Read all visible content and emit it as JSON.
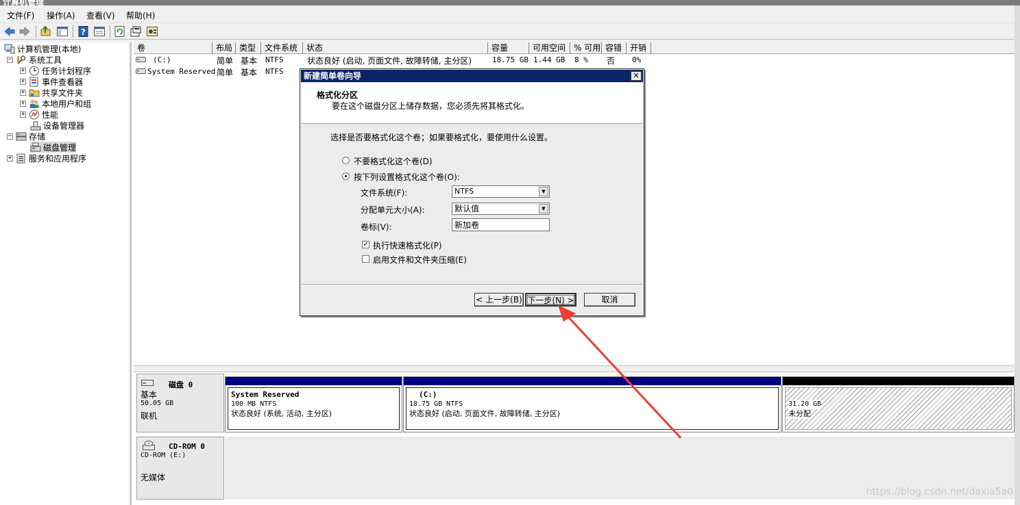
{
  "window": {
    "title": "计算机管理"
  },
  "menu": [
    "文件(F)",
    "操作(A)",
    "查看(V)",
    "帮助(H)"
  ],
  "toolbar": [
    "back-icon",
    "forward-icon",
    "up-icon",
    "show-tree-icon",
    "help-icon",
    "properties-icon",
    "refresh-icon",
    "export-icon",
    "settings-icon"
  ],
  "tree": {
    "root": "计算机管理(本地)",
    "system_tools": "系统工具",
    "task_scheduler": "任务计划程序",
    "event_viewer": "事件查看器",
    "shared_folders": "共享文件夹",
    "local_users": "本地用户和组",
    "performance": "性能",
    "device_manager": "设备管理器",
    "storage": "存储",
    "disk_management": "磁盘管理",
    "services": "服务和应用程序"
  },
  "volumes": {
    "columns": [
      "卷",
      "布局",
      "类型",
      "文件系统",
      "状态",
      "容量",
      "可用空间",
      "% 可用",
      "容错",
      "开销"
    ],
    "rows": [
      {
        "name": "(C:)",
        "layout": "简单",
        "type": "基本",
        "fs": "NTFS",
        "status": "状态良好 (启动, 页面文件, 故障转储, 主分区)",
        "capacity": "18.75 GB",
        "free": "1.44 GB",
        "pct": "8 %",
        "fault": "否",
        "overhead": "0%"
      },
      {
        "name": "System Reserved",
        "layout": "简单",
        "type": "基本",
        "fs": "NTFS"
      }
    ]
  },
  "disk0": {
    "label": "磁盘 0",
    "type": "基本",
    "size": "50.05 GB",
    "state": "联机",
    "partitions": [
      {
        "name": "System Reserved",
        "detail": "100 MB NTFS",
        "status": "状态良好 (系统, 活动, 主分区)"
      },
      {
        "name": "(C:)",
        "detail": "18.75 GB NTFS",
        "status": "状态良好 (启动, 页面文件, 故障转储, 主分区)"
      },
      {
        "name": "",
        "detail": "31.20 GB",
        "status": "未分配"
      }
    ]
  },
  "cdrom": {
    "label": "CD-ROM 0",
    "drive": "CD-ROM (E:)",
    "media": "无媒体"
  },
  "dialog": {
    "title": "新建简单卷向导",
    "heading": "格式化分区",
    "subheading": "要在这个磁盘分区上储存数据，您必须先将其格式化。",
    "prompt": "选择是否要格式化这个卷；如果要格式化，要使用什么设置。",
    "opt_no_format": "不要格式化这个卷(D)",
    "opt_format": "按下列设置格式化这个卷(O):",
    "fs_label": "文件系统(F):",
    "fs_value": "NTFS",
    "alloc_label": "分配单元大小(A):",
    "alloc_value": "默认值",
    "vol_label": "卷标(V):",
    "vol_value": "新加卷",
    "quick_format": "执行快速格式化(P)",
    "compression": "启用文件和文件夹压缩(E)",
    "back": "< 上一步(B)",
    "next": "下一步(N) >",
    "cancel": "取消"
  },
  "watermark": "https://blog.csdn.net/daxia5a0"
}
